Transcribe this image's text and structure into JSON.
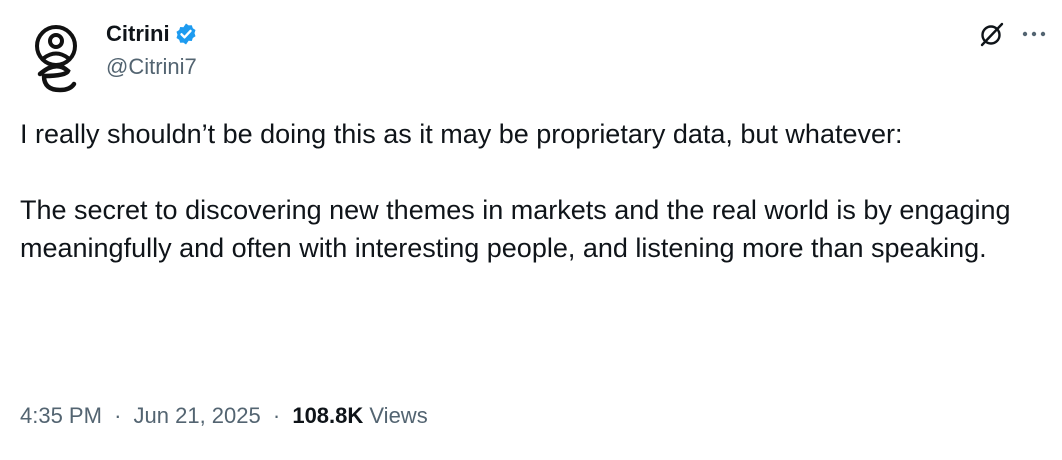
{
  "author": {
    "display_name": "Citrini",
    "handle": "@Citrini7",
    "verified_color": "#1d9bf0",
    "avatar_icon": "citrini-logo-icon"
  },
  "actions": {
    "grok_icon": "grok-icon",
    "more_icon": "more-icon"
  },
  "tweet": {
    "paragraph_1": "I really shouldn’t be doing this as it may be proprietary data, but whatever:",
    "paragraph_2": "The secret to discovering new themes in markets and the real world is by engaging meaningfully and often with interesting people, and listening more than speaking."
  },
  "meta": {
    "time": "4:35 PM",
    "separator": "·",
    "date": "Jun 21, 2025",
    "views_count": "108.8K",
    "views_label": "Views"
  }
}
